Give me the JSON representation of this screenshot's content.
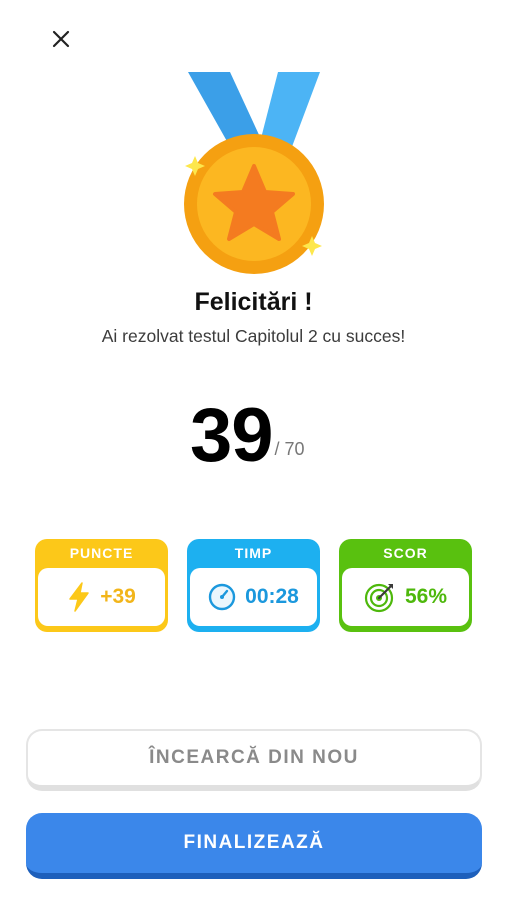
{
  "header": {
    "close_icon": "close-icon"
  },
  "medal": {
    "icon": "medal-star-icon",
    "ribbon_color": "#40a8f0",
    "coin_color": "#f6a814",
    "star_color": "#f37a1f"
  },
  "result": {
    "title": "Felicitări !",
    "subtitle": "Ai rezolvat testul Capitolul 2 cu succes!",
    "score": "39",
    "total": "/ 70"
  },
  "stats": {
    "points": {
      "label": "PUNCTE",
      "value": "+39",
      "icon": "lightning-icon",
      "color": "#fcc819"
    },
    "time": {
      "label": "TIMP",
      "value": "00:28",
      "icon": "stopwatch-icon",
      "color": "#1db0f0"
    },
    "score": {
      "label": "SCOR",
      "value": "56%",
      "icon": "target-icon",
      "color": "#59c10f"
    }
  },
  "actions": {
    "retry_label": "ÎNCEARCĂ DIN NOU",
    "finish_label": "FINALIZEAZĂ",
    "finish_color": "#3b87ea"
  }
}
